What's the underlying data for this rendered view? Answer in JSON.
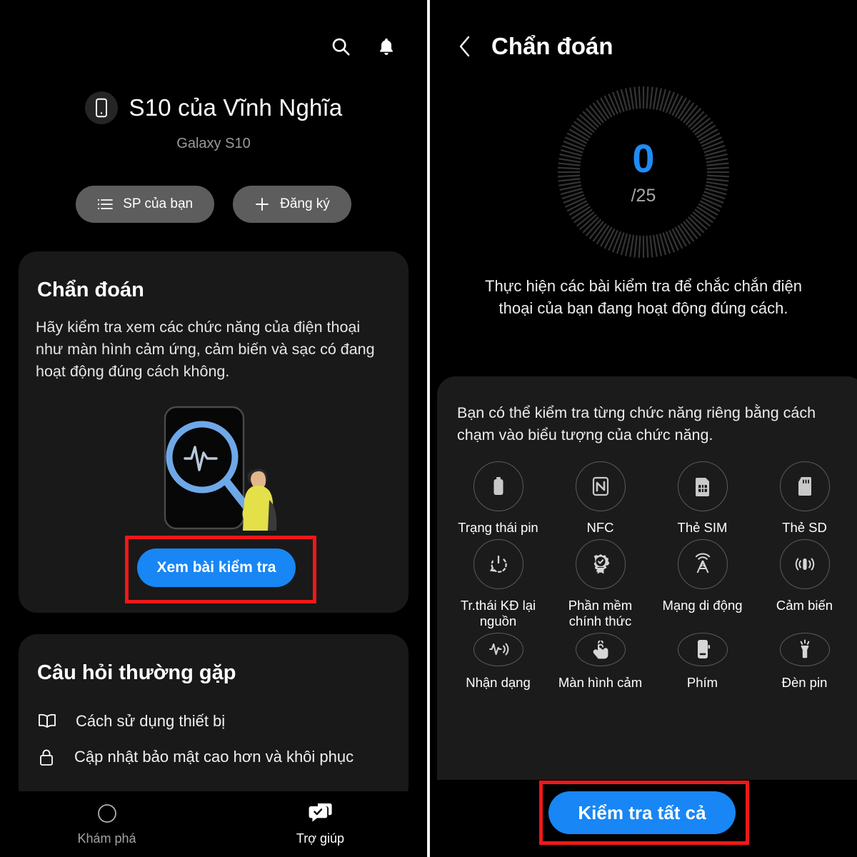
{
  "left": {
    "topbar": {
      "search_icon": "search-icon",
      "bell_icon": "notification-bell-icon"
    },
    "device": {
      "icon": "phone-icon",
      "name": "S10 của Vĩnh Nghĩa",
      "model": "Galaxy S10"
    },
    "pills": [
      {
        "icon": "list-icon",
        "label": "SP của bạn"
      },
      {
        "icon": "plus-icon",
        "label": "Đăng ký"
      }
    ],
    "diagnostics_card": {
      "title": "Chẩn đoán",
      "body": "Hãy kiểm tra xem các chức năng của điện thoại như màn hình cảm ứng, cảm biến và sạc có đang hoạt động đúng cách không.",
      "illustration": "phone-magnifier-pulse-illustration",
      "button_label": "Xem bài kiểm tra",
      "button_color": "#1886f4",
      "highlight_color": "#f01818"
    },
    "faq_card": {
      "title": "Câu hỏi thường gặp",
      "items": [
        {
          "icon": "book-icon",
          "label": "Cách sử dụng thiết bị"
        },
        {
          "icon": "lock-icon",
          "label": "Cập nhật bảo mật cao hơn và khôi phục"
        }
      ]
    },
    "bottom_nav": [
      {
        "icon": "compass-icon",
        "label": "Khám phá",
        "active": false
      },
      {
        "icon": "chat-check-icon",
        "label": "Trợ giúp",
        "active": true
      }
    ]
  },
  "right": {
    "header": {
      "back_icon": "chevron-left-icon",
      "title": "Chẩn đoán"
    },
    "gauge": {
      "value": "0",
      "total": "/25",
      "value_color": "#1f8cf5",
      "ticks": 120
    },
    "description": "Thực hiện các bài kiểm tra để chắc chắn điện thoại của bạn đang hoạt động đúng cách.",
    "card": {
      "intro": "Bạn có thể kiểm tra từng chức năng riêng bằng cách chạm vào biểu tượng của chức năng.",
      "tests": [
        {
          "icon": "battery-icon",
          "label": "Trạng thái pin"
        },
        {
          "icon": "nfc-icon",
          "label": "NFC"
        },
        {
          "icon": "sim-card-icon",
          "label": "Thẻ SIM"
        },
        {
          "icon": "sd-card-icon",
          "label": "Thẻ SD"
        },
        {
          "icon": "power-restart-icon",
          "label": "Tr.thái KĐ lại nguồn"
        },
        {
          "icon": "certified-badge-icon",
          "label": "Phần mềm chính thức"
        },
        {
          "icon": "cell-tower-icon",
          "label": "Mạng di động"
        },
        {
          "icon": "vibration-sensor-icon",
          "label": "Cảm biến"
        },
        {
          "icon": "audio-wave-icon",
          "label": "Nhận dạng"
        },
        {
          "icon": "touch-icon",
          "label": "Màn hình cảm"
        },
        {
          "icon": "phone-key-icon",
          "label": "Phím"
        },
        {
          "icon": "flashlight-icon",
          "label": "Đèn pin"
        }
      ]
    },
    "primary_button": {
      "label": "Kiểm tra tất cả",
      "color": "#1886f4",
      "highlight_color": "#f01818"
    }
  }
}
